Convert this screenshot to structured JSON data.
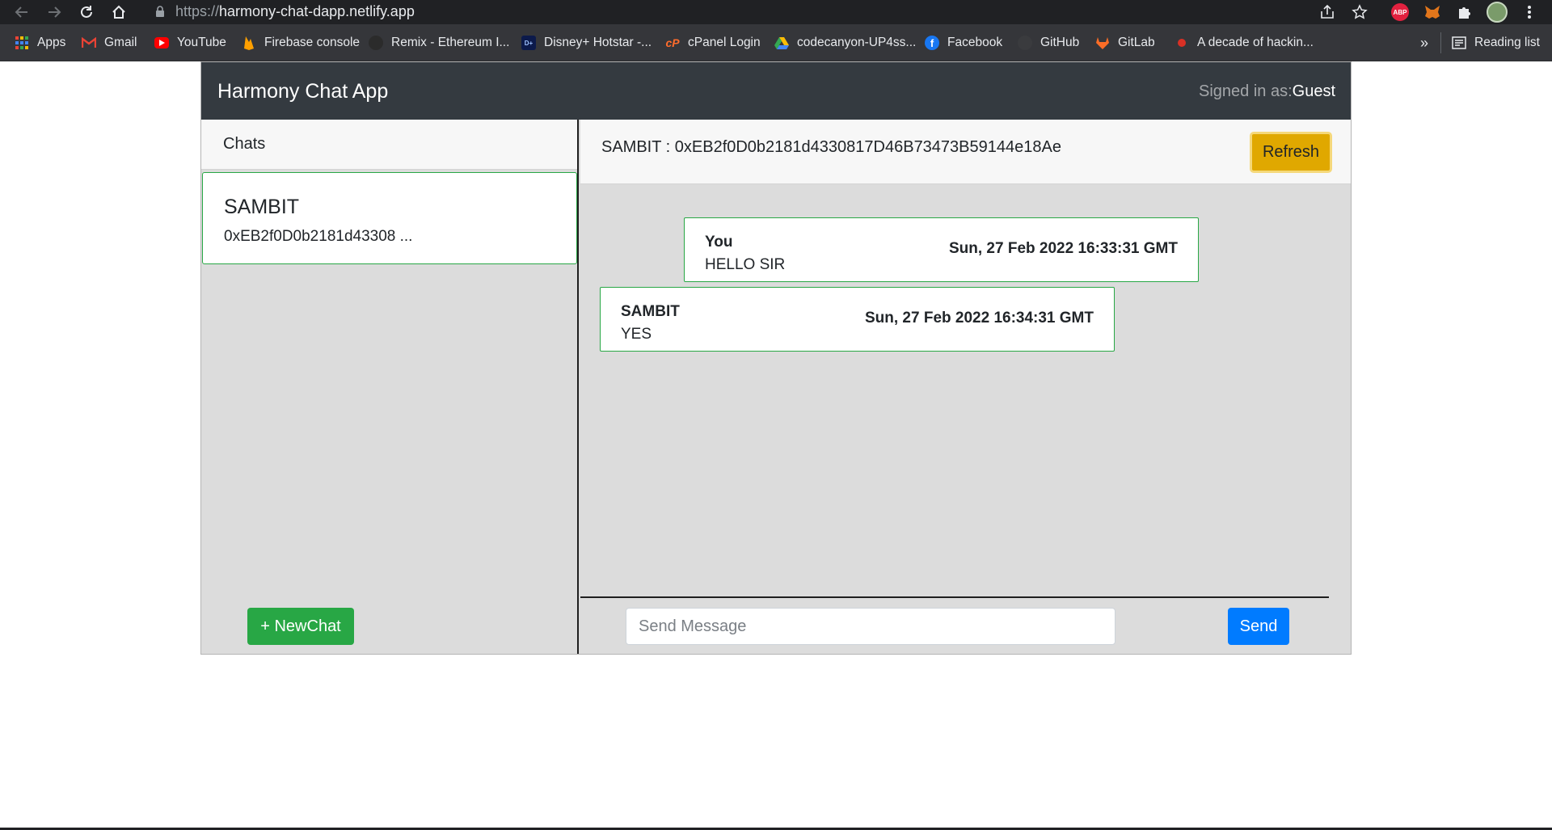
{
  "browser": {
    "url_scheme": "https://",
    "url_host": "harmony-chat-dapp.netlify.app",
    "bookmarks": [
      {
        "label": "Apps",
        "icon": "apps-grid-icon"
      },
      {
        "label": "Gmail",
        "icon": "gmail-icon"
      },
      {
        "label": "YouTube",
        "icon": "youtube-icon"
      },
      {
        "label": "Firebase console",
        "icon": "firebase-icon"
      },
      {
        "label": "Remix - Ethereum I...",
        "icon": "remix-icon"
      },
      {
        "label": "Disney+ Hotstar -...",
        "icon": "hotstar-icon"
      },
      {
        "label": "cPanel Login",
        "icon": "cpanel-icon"
      },
      {
        "label": "codecanyon-UP4ss...",
        "icon": "google-drive-icon"
      },
      {
        "label": "Facebook",
        "icon": "facebook-icon"
      },
      {
        "label": "GitHub",
        "icon": "github-icon"
      },
      {
        "label": "GitLab",
        "icon": "gitlab-icon"
      },
      {
        "label": "A decade of hackin...",
        "icon": "site-icon"
      }
    ],
    "more_label": "»",
    "reading_list": "Reading list",
    "abp_label": "ABP"
  },
  "app": {
    "brand": "Harmony Chat App",
    "signed_in_prefix": "Signed in as:",
    "signed_in_user": "Guest",
    "sidebar": {
      "header": "Chats",
      "chats": [
        {
          "name": "SAMBIT",
          "address": "0xEB2f0D0b2181d43308 ..."
        }
      ],
      "new_chat_label": "+ NewChat"
    },
    "conversation": {
      "title": "SAMBIT : 0xEB2f0D0b2181d4330817D46B73473B59144e18Ae",
      "refresh_label": "Refresh",
      "messages": [
        {
          "sender": "You",
          "text": "HELLO SIR",
          "time": "Sun, 27 Feb 2022 16:33:31 GMT"
        },
        {
          "sender": "SAMBIT",
          "text": "YES",
          "time": "Sun, 27 Feb 2022 16:34:31 GMT"
        }
      ],
      "input_placeholder": "Send Message",
      "send_label": "Send"
    }
  },
  "colors": {
    "navbar": "#343a40",
    "success": "#28a745",
    "warning": "#e0a800",
    "primary": "#007bff"
  }
}
